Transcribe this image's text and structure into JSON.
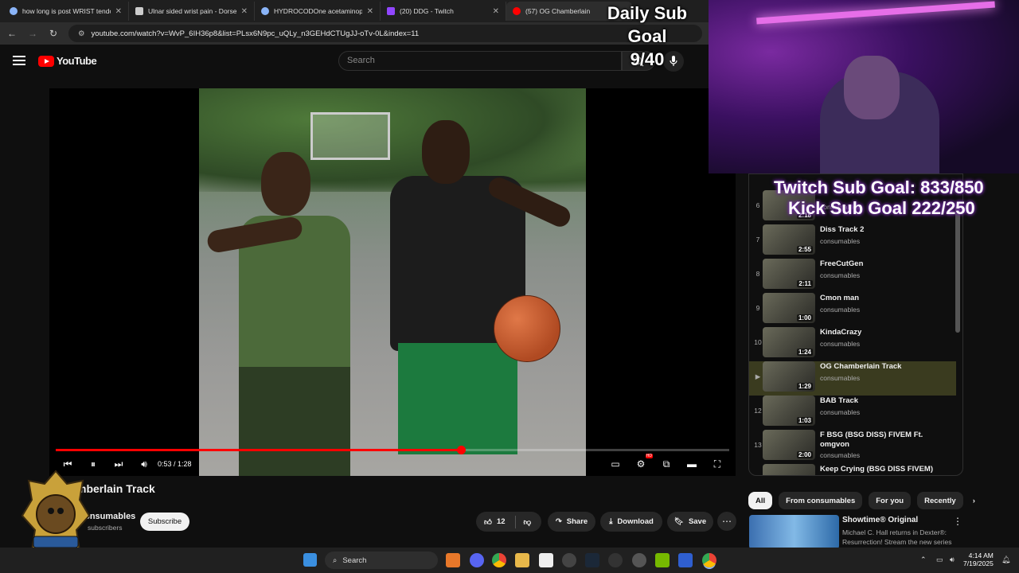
{
  "browser": {
    "tabs": [
      {
        "label": "how long is post WRIST tendo",
        "icon": "google-icon"
      },
      {
        "label": "Ulnar sided wrist pain - Dorset",
        "icon": "page-icon"
      },
      {
        "label": "HYDROCODOne acetaminophe",
        "icon": "google-icon"
      },
      {
        "label": "(20) DDG - Twitch",
        "icon": "twitch-icon"
      },
      {
        "label": "(57) OG Chamberlain",
        "icon": "youtube-icon",
        "active": true
      }
    ],
    "url": "youtube.com/watch?v=WvP_6IH36p8&list=PLsx6N9pc_uQLy_n3GEHdCTUgJJ-oTv-0L&index=11"
  },
  "youtube": {
    "logo_text": "YouTube",
    "search_placeholder": "Search"
  },
  "player": {
    "time_display": "0:53 / 1:28",
    "progress_fraction": 0.602,
    "hd_badge": "HD"
  },
  "video": {
    "title_visible": "mberlain Track",
    "channel": "consumables",
    "subscribers": "subscribers",
    "subscribe_label": "Subscribe",
    "likes": "12",
    "share_label": "Share",
    "download_label": "Download",
    "save_label": "Save"
  },
  "stream_overlay": {
    "daily_goal_line1": "Daily Sub Goal",
    "daily_goal_line2": "9/40",
    "twitch_goal": "Twitch Sub Goal: 833/850",
    "kick_goal": "Kick Sub Goal 222/250"
  },
  "playlist": {
    "items": [
      {
        "num": "6",
        "title": "",
        "channel": "consumables",
        "duration": "2:18"
      },
      {
        "num": "7",
        "title": "Diss Track 2",
        "channel": "consumables",
        "duration": "2:55"
      },
      {
        "num": "8",
        "title": "FreeCutGen",
        "channel": "consumables",
        "duration": "2:11"
      },
      {
        "num": "9",
        "title": "Cmon man",
        "channel": "consumables",
        "duration": "1:00"
      },
      {
        "num": "10",
        "title": "KindaCrazy",
        "channel": "consumables",
        "duration": "1:24"
      },
      {
        "num": "▶",
        "title": "OG Chamberlain Track",
        "channel": "consumables",
        "duration": "1:29",
        "active": true
      },
      {
        "num": "12",
        "title": "BAB Track",
        "channel": "consumables",
        "duration": "1:03"
      },
      {
        "num": "13",
        "title": "F BSG (BSG DISS) FIVEM Ft. omgvon",
        "channel": "consumables",
        "duration": "2:00"
      },
      {
        "num": "",
        "title": "Keep Crying (BSG DISS FIVEM)",
        "channel": "",
        "duration": ""
      }
    ]
  },
  "chips": [
    "All",
    "From consumables",
    "For you",
    "Recently"
  ],
  "recommendation": {
    "title": "Showtime® Original",
    "desc": "Michael C. Hall returns in Dexter®: Resurrection! Stream the new series"
  },
  "taskbar": {
    "search_label": "Search",
    "time": "4:14 AM",
    "date": "7/19/2025"
  },
  "colors": {
    "accent": "#ff0000",
    "background": "#0f0f0f",
    "active_row": "#3a3b1f"
  }
}
